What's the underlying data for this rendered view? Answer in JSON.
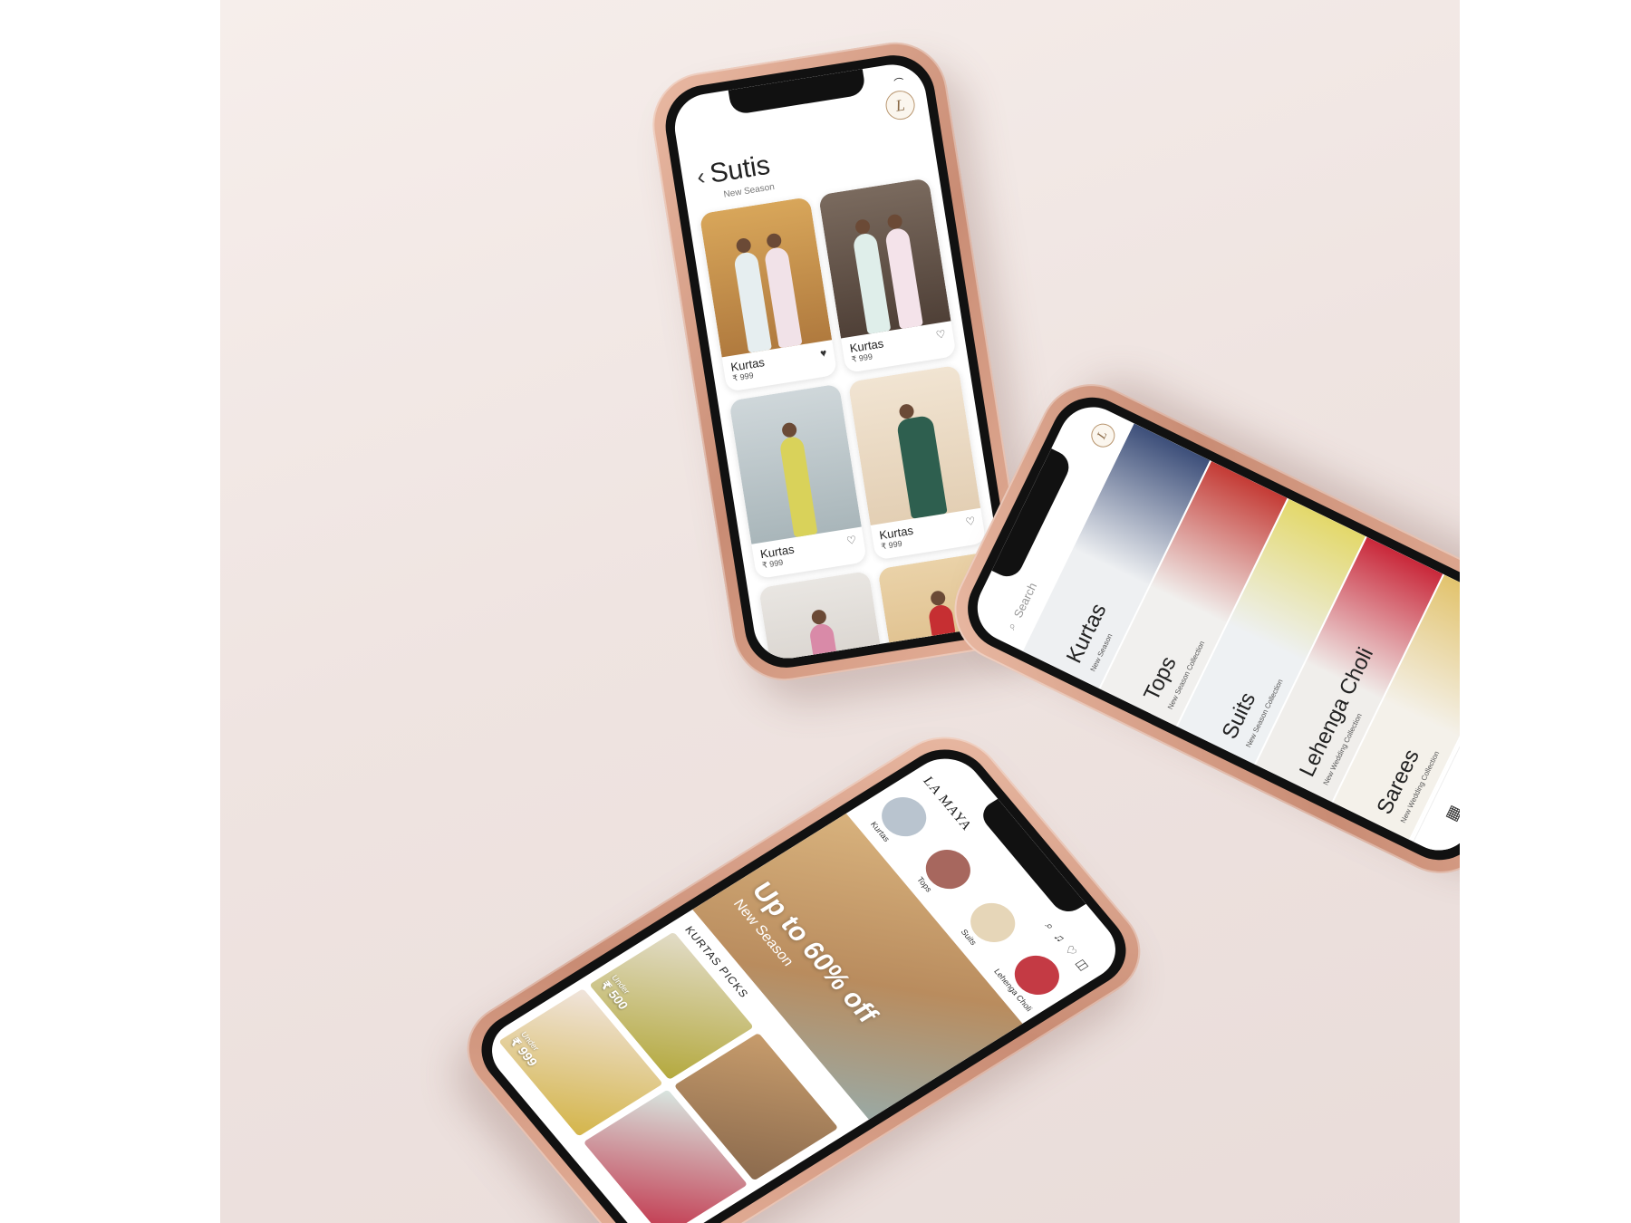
{
  "colors": {
    "accent": "#c98c74",
    "gold": "#b8956e"
  },
  "phone1": {
    "title": "Sutis",
    "subtitle": "New Season",
    "back_icon": "chevron-left-icon",
    "logo_letter": "L",
    "products": [
      {
        "name": "Kurtas",
        "price": "₹ 999",
        "favorite": true
      },
      {
        "name": "Kurtas",
        "price": "₹ 999",
        "favorite": false
      },
      {
        "name": "Kurtas",
        "price": "₹ 999",
        "favorite": false
      },
      {
        "name": "Kurtas",
        "price": "₹ 999",
        "favorite": false
      },
      {
        "name": "",
        "price": "",
        "favorite": false
      },
      {
        "name": "",
        "price": "",
        "favorite": false
      }
    ]
  },
  "phone2": {
    "search_placeholder": "Search",
    "logo_letter": "L",
    "categories": [
      {
        "label": "Kurtas",
        "sub": "New Season"
      },
      {
        "label": "Tops",
        "sub": "New Season Collection"
      },
      {
        "label": "Suits",
        "sub": "New Season Collection"
      },
      {
        "label": "Lehenga Choli",
        "sub": "New Wedding Collection"
      },
      {
        "label": "Sarees",
        "sub": "New Wedding Collection"
      }
    ]
  },
  "phone3": {
    "brand": "LA MAYA",
    "logo_letter": "L",
    "categories": [
      "Kurtas",
      "Tops",
      "Suits",
      "Lehenga Choli"
    ],
    "banner_title": "Up to 60% off",
    "banner_subtitle": "New Season",
    "picks_title": "KURTAS PICKS",
    "picks": [
      {
        "label": "Under",
        "price": "₹ 500"
      },
      {
        "label": "",
        "price": ""
      },
      {
        "label": "Under",
        "price": "₹ 999"
      },
      {
        "label": "",
        "price": ""
      }
    ]
  }
}
